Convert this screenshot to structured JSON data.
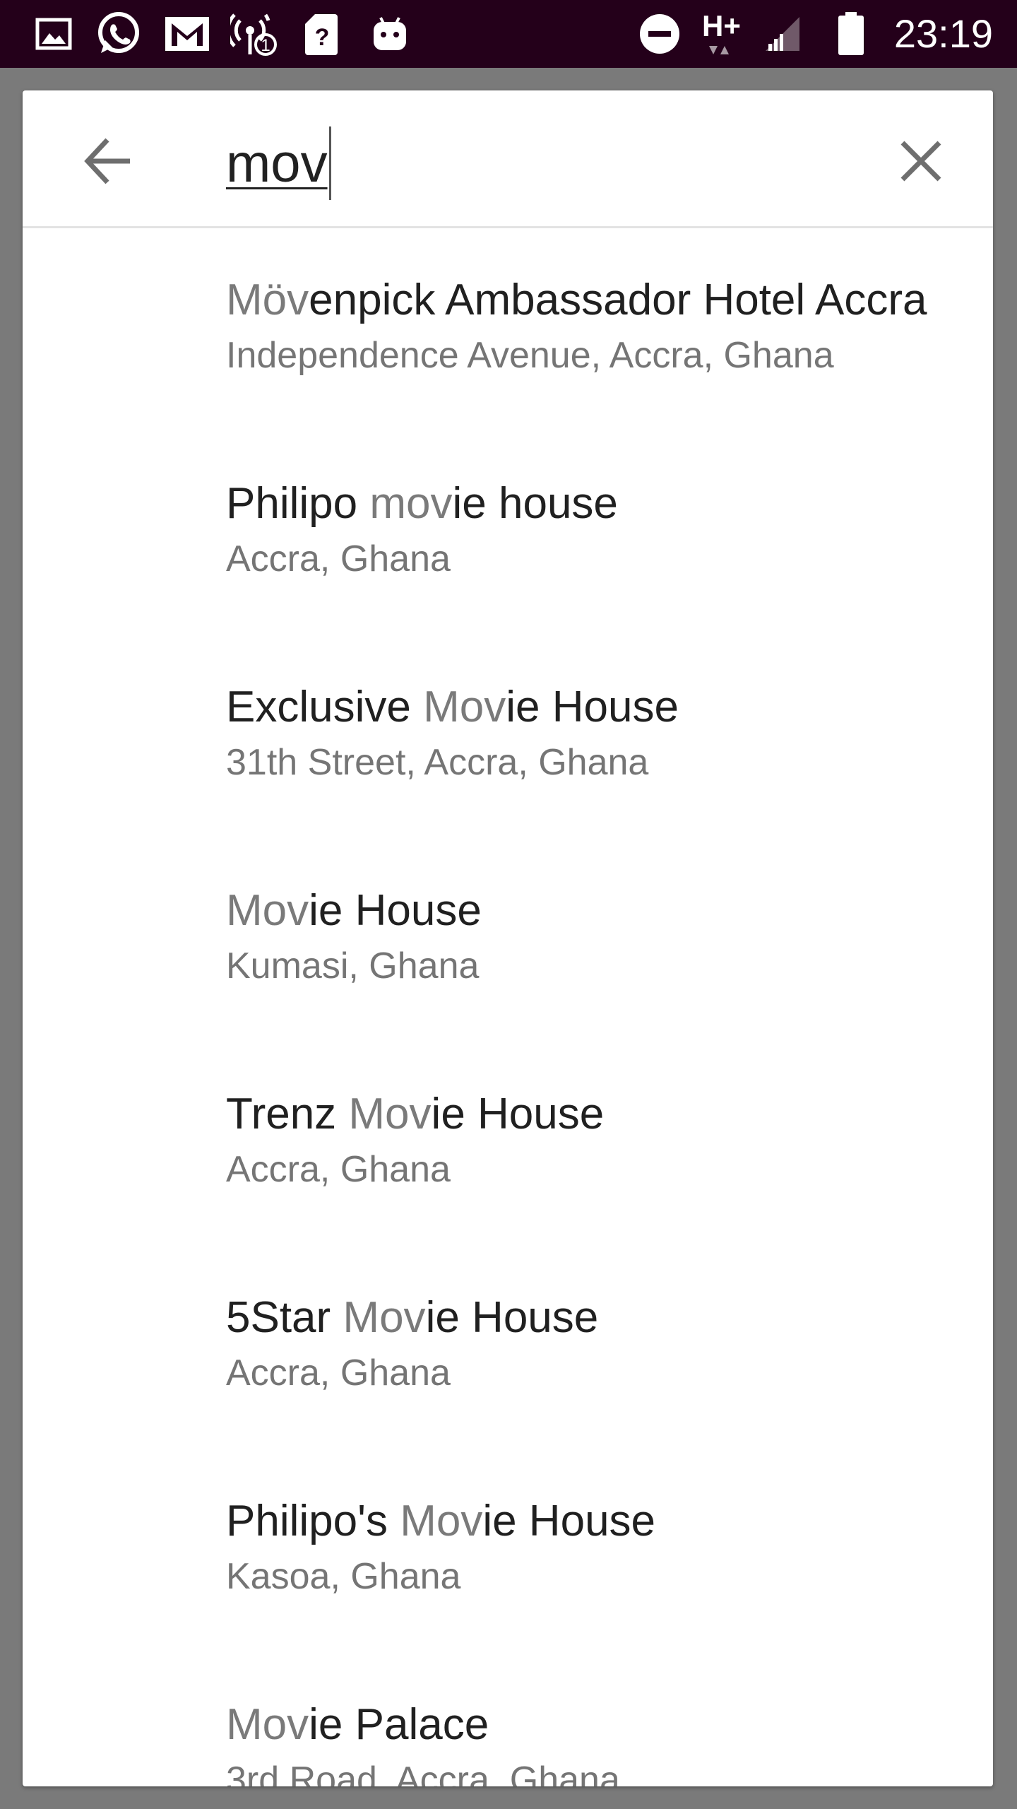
{
  "status_bar": {
    "time": "23:19",
    "network_label": "H+",
    "icons": [
      "gallery-icon",
      "whatsapp-icon",
      "gmail-icon",
      "hotspot-icon",
      "sim-unknown-icon",
      "android-icon",
      "do-not-disturb-icon",
      "network-hplus-icon",
      "signal-icon",
      "battery-icon"
    ]
  },
  "search": {
    "query": "mov",
    "back_icon": "arrow-left-icon",
    "clear_icon": "close-icon"
  },
  "results": [
    {
      "title_pre": "",
      "title_match": "Möv",
      "title_post": "enpick Ambassador Hotel Accra",
      "subtitle": "Independence Avenue, Accra, Ghana"
    },
    {
      "title_pre": "Philipo ",
      "title_match": "mov",
      "title_post": "ie house",
      "subtitle": "Accra, Ghana"
    },
    {
      "title_pre": "Exclusive ",
      "title_match": "Mov",
      "title_post": "ie House",
      "subtitle": "31th Street, Accra, Ghana"
    },
    {
      "title_pre": "",
      "title_match": "Mov",
      "title_post": "ie House",
      "subtitle": "Kumasi, Ghana"
    },
    {
      "title_pre": "Trenz ",
      "title_match": "Mov",
      "title_post": "ie House",
      "subtitle": "Accra, Ghana"
    },
    {
      "title_pre": "5Star ",
      "title_match": "Mov",
      "title_post": "ie House",
      "subtitle": "Accra, Ghana"
    },
    {
      "title_pre": "Philipo's ",
      "title_match": "Mov",
      "title_post": "ie House",
      "subtitle": "Kasoa, Ghana"
    },
    {
      "title_pre": "",
      "title_match": "Mov",
      "title_post": "ie Palace",
      "subtitle": "3rd Road, Accra, Ghana"
    }
  ],
  "colors": {
    "status_bar_bg": "#24001a",
    "backdrop": "#7a7a7a",
    "title_text": "#202020",
    "match_text": "#7a7a7a",
    "subtitle_text": "#757575"
  }
}
